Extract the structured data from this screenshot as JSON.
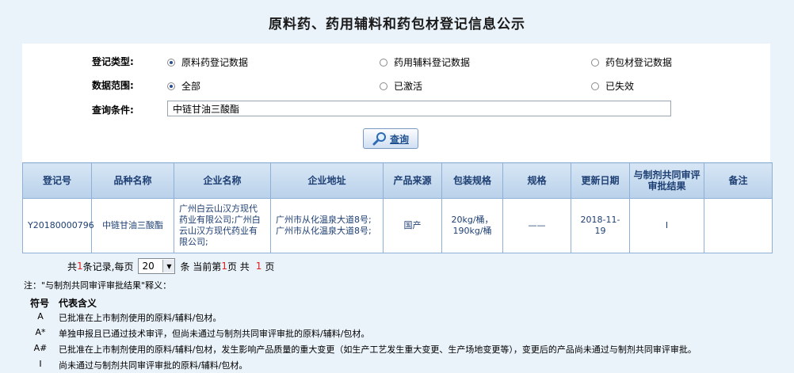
{
  "page_title": "原料药、药用辅料和药包材登记信息公示",
  "form": {
    "reg_type_label": "登记类型:",
    "reg_type_options": [
      "原料药登记数据",
      "药用辅料登记数据",
      "药包材登记数据"
    ],
    "reg_type_selected": 0,
    "scope_label": "数据范围:",
    "scope_options": [
      "全部",
      "已激活",
      "已失效"
    ],
    "scope_selected": 0,
    "query_label": "查询条件:",
    "query_value": "中链甘油三酸酯",
    "query_button": "查询"
  },
  "table": {
    "headers": [
      "登记号",
      "品种名称",
      "企业名称",
      "企业地址",
      "产品来源",
      "包装规格",
      "规格",
      "更新日期",
      "与制剂共同审评审批结果",
      "备注"
    ],
    "rows": [
      [
        "Y20180000796",
        "中链甘油三酸酯",
        "广州白云山汉方现代药业有限公司;广州白云山汉方现代药业有限公司;",
        "广州市从化温泉大道8号;广州市从化温泉大道8号;",
        "国产",
        "20kg/桶，190kg/桶",
        "——",
        "2018-11-19",
        "I",
        ""
      ]
    ]
  },
  "pager": {
    "prefix": "共",
    "count": "1",
    "mid": "条记录,每页",
    "page_size": "20",
    "current_prefix": "条 当前第",
    "current": "1",
    "total_prefix": "页 共",
    "total": "1",
    "suffix": "页"
  },
  "notes": {
    "heading": "注：\"与制剂共同审评审批结果\"释义：",
    "col_symbol": "符号",
    "col_meaning": "代表含义",
    "items": [
      {
        "symbol": "A",
        "meaning": "已批准在上市制剂使用的原料/辅料/包材。"
      },
      {
        "symbol": "A*",
        "meaning": "单独申报且已通过技术审评，但尚未通过与制剂共同审评审批的原料/辅料/包材。"
      },
      {
        "symbol": "A#",
        "meaning": "已批准在上市制剂使用的原料/辅料/包材，发生影响产品质量的重大变更（如生产工艺发生重大变更、生产场地变更等），变更后的产品尚未通过与制剂共同审评审批。"
      },
      {
        "symbol": "I",
        "meaning": "尚未通过与制剂共同审评审批的原料/辅料/包材。"
      }
    ]
  },
  "colors": {
    "header_text": "#1e3f73",
    "pager_red": "#e02020",
    "page_bg": "#eaf2fa"
  },
  "icons": {
    "query_button": "magnifier-icon",
    "page_size_dropdown": "chevron-down-icon"
  }
}
